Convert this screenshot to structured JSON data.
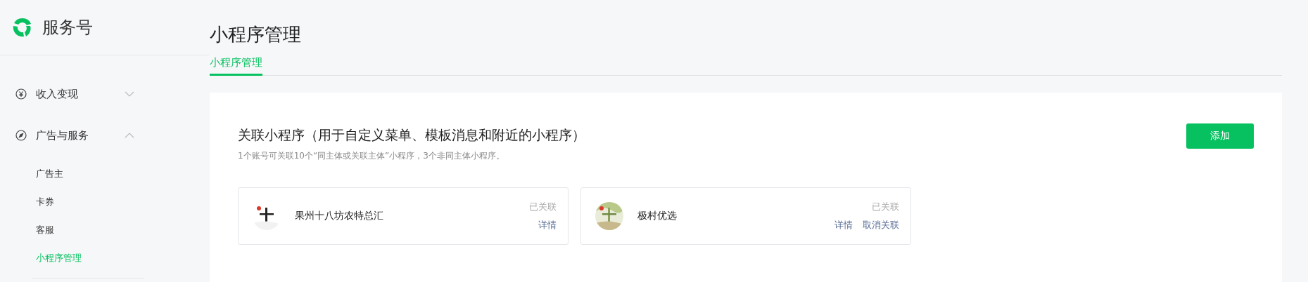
{
  "brand": {
    "name": "服务号"
  },
  "sidebar": {
    "groups": [
      {
        "label": "收入变现",
        "kind": "income",
        "expanded": false
      },
      {
        "label": "广告与服务",
        "kind": "service",
        "expanded": true,
        "children": [
          {
            "label": "广告主",
            "selected": false
          },
          {
            "label": "卡券",
            "selected": false
          },
          {
            "label": "客服",
            "selected": false
          },
          {
            "label": "小程序管理",
            "selected": true
          }
        ]
      }
    ]
  },
  "page": {
    "title": "小程序管理",
    "tabs": [
      {
        "label": "小程序管理",
        "selected": true
      }
    ]
  },
  "section": {
    "title": "关联小程序（用于自定义菜单、模板消息和附近的小程序）",
    "note": "1个账号可关联10个“同主体或关联主体”小程序，3个非同主体小程序。",
    "add_button": "添加",
    "apps": [
      {
        "name": "果州十八坊农特总汇",
        "status": "已关联",
        "avatar": {
          "kind": "picture"
        },
        "actions": [
          "详情"
        ]
      },
      {
        "name": "极村优选",
        "status": "已关联",
        "avatar": {
          "kind": "picture"
        },
        "actions": [
          "详情",
          "取消关联"
        ]
      }
    ]
  }
}
